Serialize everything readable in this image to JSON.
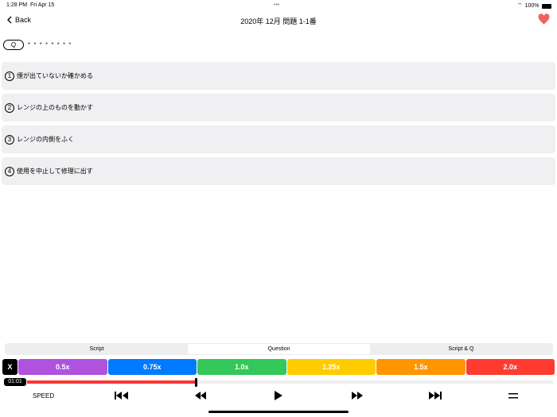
{
  "status_bar": {
    "time": "1:28 PM",
    "date": "Fri Apr 15",
    "dots": "•••",
    "battery": "100%"
  },
  "nav": {
    "back": "Back",
    "title": "2020年 12月 問題 1-1番"
  },
  "question": {
    "label": "Q",
    "stars": "* * * * * * * *"
  },
  "options": [
    {
      "num": "1",
      "text": "煙が出ていないか確かめる"
    },
    {
      "num": "2",
      "text": "レンジの上のものを動かす"
    },
    {
      "num": "3",
      "text": "レンジの内側をふく"
    },
    {
      "num": "4",
      "text": "使用を中止して修理に出す"
    }
  ],
  "tabs": [
    {
      "label": "Script"
    },
    {
      "label": "Question"
    },
    {
      "label": "Script & Q"
    }
  ],
  "active_tab": "Question",
  "speed_close": "X",
  "speeds": [
    {
      "label": "0.5x",
      "color": "#af52de"
    },
    {
      "label": "0.75x",
      "color": "#007aff"
    },
    {
      "label": "1.0x",
      "color": "#34c759"
    },
    {
      "label": "1.25x",
      "color": "#ffcc00"
    },
    {
      "label": "1.5x",
      "color": "#ff9500"
    },
    {
      "label": "2.0x",
      "color": "#ff3b30"
    }
  ],
  "player": {
    "time": "01:01",
    "progress": 0.32,
    "speed_label": "SPEED"
  }
}
